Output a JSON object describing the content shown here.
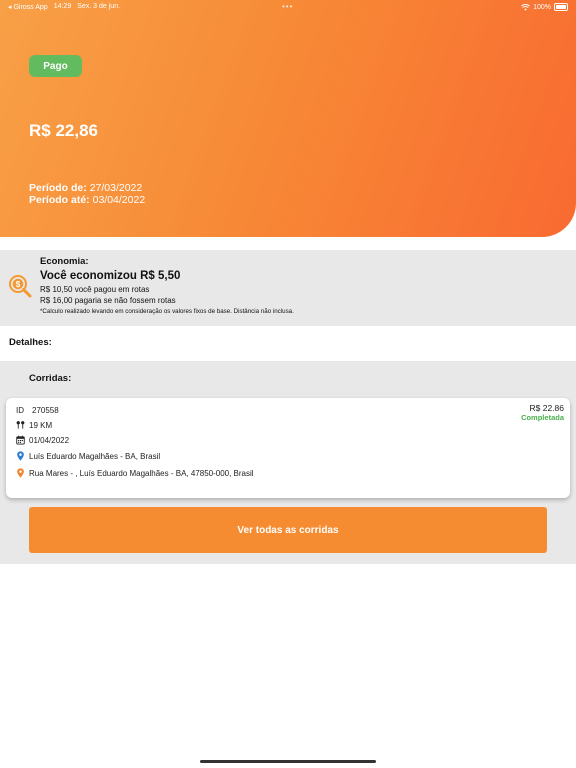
{
  "status_bar": {
    "back_app": "◂ Giross App",
    "time": "14:29",
    "date": "Sex. 3 de jun.",
    "center_dots": "•••",
    "wifi_icon": "wifi-icon",
    "battery": "100%"
  },
  "header": {
    "badge": "Pago",
    "amount": "R$ 22,86",
    "period_from_label": "Período de:",
    "period_from_value": "27/03/2022",
    "period_to_label": "Período até:",
    "period_to_value": "03/04/2022",
    "gradient_colors": [
      "#f8a047",
      "#f96a31"
    ],
    "badge_color": "#62bb5e"
  },
  "economia": {
    "icon": "money-search-icon",
    "title": "Economia:",
    "headline": "Você economizou R$ 5,50",
    "line1": "R$ 10,50 você pagou em rotas",
    "line2": "R$ 16,00 pagaria se não fossem rotas",
    "note": "*Calculo realizado levando em consideração os valores fixos de base. Distância não inclusa."
  },
  "detalhes": {
    "title": "Detalhes:"
  },
  "corridas": {
    "title": "Corridas:",
    "card": {
      "id_label": "ID",
      "id": "270558",
      "distance": "19 KM",
      "date": "01/04/2022",
      "origin": "Luís Eduardo Magalhães - BA, Brasil",
      "destination": "Rua Mares - , Luís Eduardo Magalhães - BA, 47850-000, Brasil",
      "price": "R$ 22.86",
      "status": "Completada"
    },
    "button": "Ver todas as corridas",
    "button_color": "#f58c32",
    "status_color": "#4caf50"
  }
}
